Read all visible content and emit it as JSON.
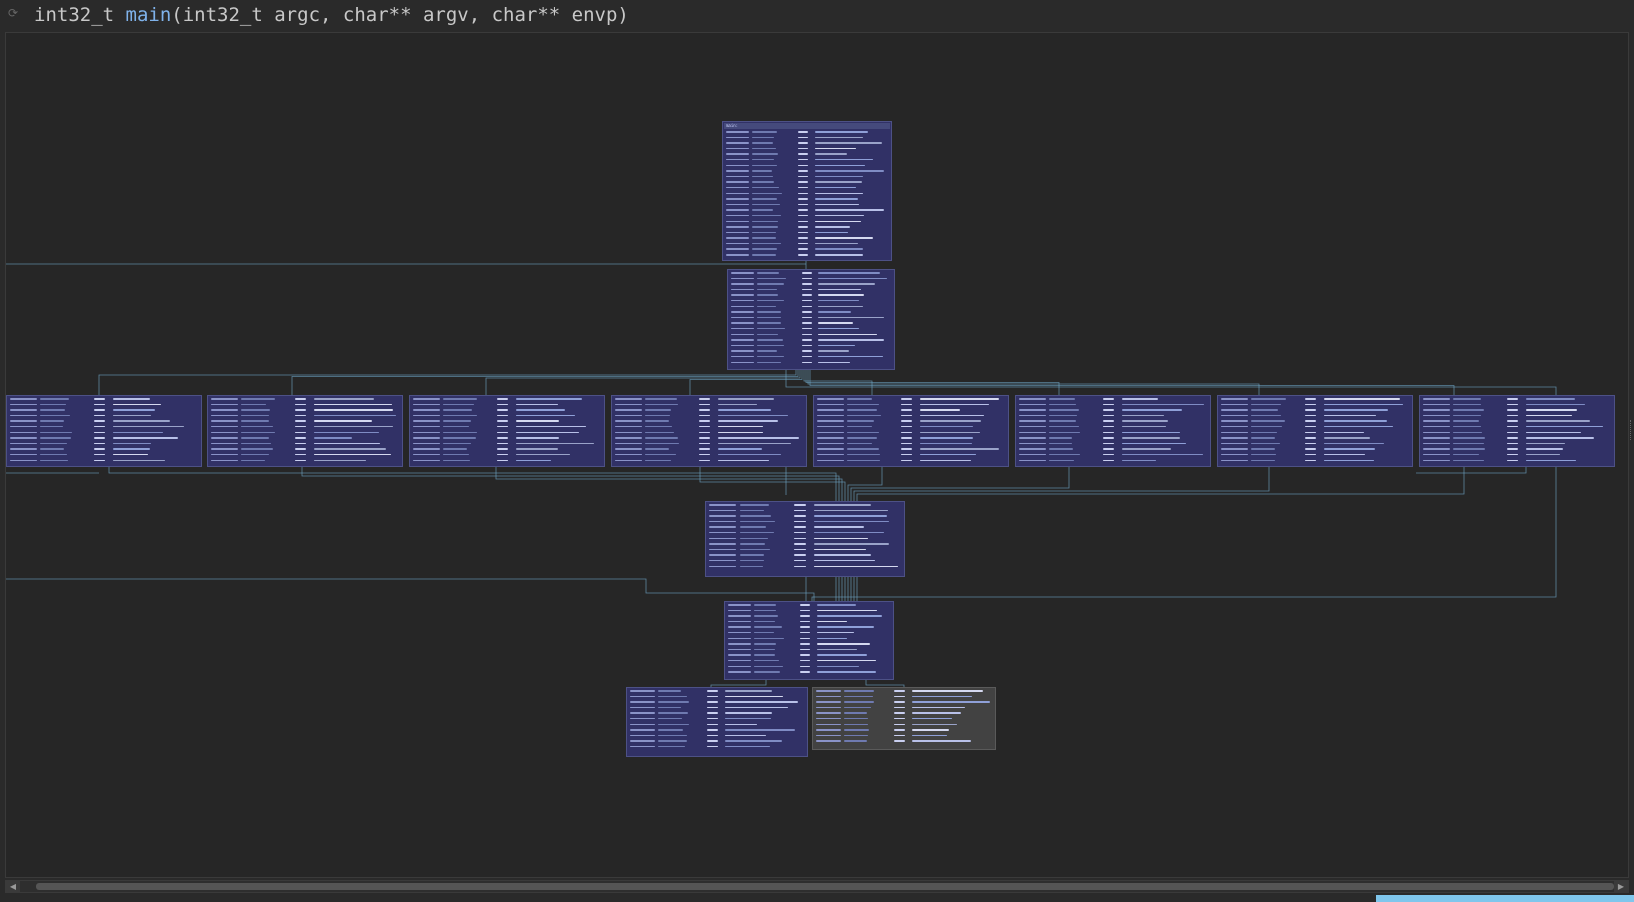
{
  "header": {
    "return_type": "int32_t",
    "function_name": "main",
    "signature_rest": "(int32_t argc, char** argv, char** envp)"
  },
  "colors": {
    "background": "#2a2a2a",
    "block_fill": "#313166",
    "block_border": "#4d5186",
    "grey_block": "#424242",
    "edge": "#6fa8c8",
    "status_bar": "#7fc6ec"
  },
  "icons": {
    "refresh": "refresh-icon",
    "scroll_left": "arrow-left-icon",
    "scroll_right": "arrow-right-icon"
  },
  "graph": {
    "entry_label": "main:",
    "blocks": [
      {
        "id": "entry",
        "rows": 24
      },
      {
        "id": "switch",
        "rows": 17
      },
      {
        "id": "case-1",
        "rows": 12
      },
      {
        "id": "case-2",
        "rows": 12
      },
      {
        "id": "case-3",
        "rows": 12
      },
      {
        "id": "case-4",
        "rows": 12
      },
      {
        "id": "case-5",
        "rows": 12
      },
      {
        "id": "case-6",
        "rows": 12
      },
      {
        "id": "case-7",
        "rows": 12
      },
      {
        "id": "case-8",
        "rows": 12
      },
      {
        "id": "default",
        "rows": 12
      },
      {
        "id": "loop-check",
        "rows": 13
      },
      {
        "id": "exit",
        "rows": 11
      },
      {
        "id": "stack-fail",
        "rows": 10
      }
    ]
  }
}
